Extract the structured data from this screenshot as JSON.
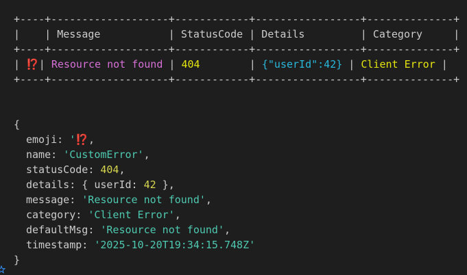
{
  "table": {
    "border_top": "+----+-------------------+------------+-----------------+--------------+",
    "header": {
      "index": "",
      "message": "Message",
      "statusCode": "StatusCode",
      "details": "Details",
      "category": "Category"
    },
    "border_mid": "+----+-------------------+------------+-----------------+--------------+",
    "row": {
      "index": "⁉️",
      "message": "Resource not found",
      "statusCode": "404",
      "details": "{\"userId\":42}",
      "category": "Client Error"
    },
    "border_bottom": "+----+-------------------+------------+-----------------+--------------+"
  },
  "object": {
    "open": "{",
    "close": "}",
    "fields": {
      "emoji_key": "emoji",
      "emoji_val": "⁉️",
      "name_key": "name",
      "name_val": "'CustomError'",
      "statusCode_key": "statusCode",
      "statusCode_val": "404",
      "details_key": "details",
      "details_inner_key": "userId",
      "details_inner_val": "42",
      "message_key": "message",
      "message_val": "'Resource not found'",
      "category_key": "category",
      "category_val": "'Client Error'",
      "defaultMsg_key": "defaultMsg",
      "defaultMsg_val": "'Resource not found'",
      "timestamp_key": "timestamp",
      "timestamp_val": "'2025-10-20T19:34:15.748Z'"
    }
  },
  "colors": {
    "background": "#1e1e1e",
    "text": "#cccccc",
    "magenta": "#d670d6",
    "yellow": "#e5e510",
    "cyan": "#29b8db",
    "string_green": "#4ec9b0",
    "number": "#d7d74f",
    "marker_blue": "#3794ff"
  },
  "icons": {
    "prompt_marker": "circle-star-icon"
  }
}
